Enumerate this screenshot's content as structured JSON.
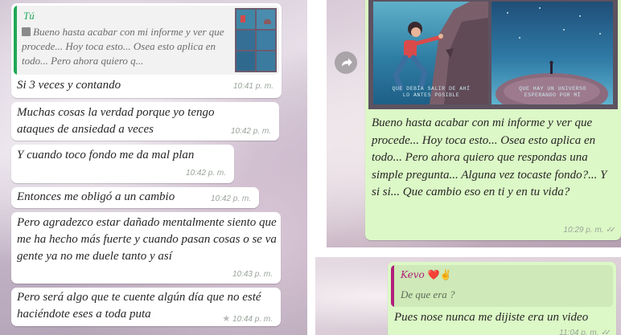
{
  "left_panel": {
    "quoted": {
      "author": "Tú",
      "text": "Bueno hasta acabar con mi informe y ver que procede... Hoy toca esto... Osea esto aplica en todo... Pero ahora quiero q...",
      "author_color": "#1fa855"
    },
    "messages": [
      {
        "text": "Si 3 veces y contando",
        "time": "10:41 p. m."
      },
      {
        "text": "Muchas cosas la verdad porque yo tengo ataques de ansiedad a veces",
        "time": "10:42 p. m."
      },
      {
        "text": "Y cuando toco fondo me da mal plan",
        "time": "10:42 p. m."
      },
      {
        "text": "Entonces me obligó a un cambio",
        "time": "10:42 p. m."
      },
      {
        "text": "Pero agradezco estar dañado mentalmente siento que me ha hecho más fuerte y cuando pasan cosas o se va gente ya no me duele tanto y así",
        "time": "10:43 p. m."
      },
      {
        "text": "Pero será algo que te cuente algún día que no esté haciéndote eses a toda puta",
        "time": "10:44 p. m.",
        "starred": true
      }
    ]
  },
  "right_top_panel": {
    "image_captions": [
      "QUE DEBÍA SALIR DE AHÍ LO ANTES POSIBLE",
      "QUE HAY UN UNIVERSO ESPERANDO POR MÍ"
    ],
    "message": "Bueno hasta acabar con mi informe y ver que procede... Hoy toca esto... Osea esto aplica en todo... Pero ahora quiero que respondas una simple pregunta... Alguna vez tocaste fondo?... Y si si... Que cambio eso en ti y en tu vida?",
    "time": "10:29 p. m.",
    "ticks": "✓✓"
  },
  "right_bottom_panel": {
    "quoted": {
      "author": "Kevo",
      "emojis": "❤️✌️",
      "text": "De que era ?",
      "author_color": "#b0207a"
    },
    "message": "Pues nose nunca me dijiste era un video",
    "time": "11:04 p. m.",
    "ticks": "✓✓"
  },
  "colors": {
    "outgoing_bubble": "#dcf8c6",
    "incoming_bubble": "#ffffff",
    "read_ticks": "#9aa39a"
  }
}
